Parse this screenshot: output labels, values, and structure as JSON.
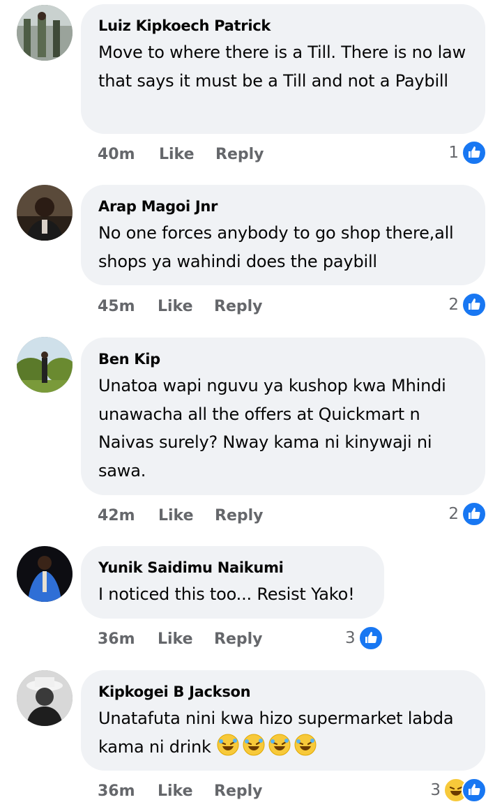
{
  "comments": [
    {
      "author": "Luiz Kipkoech Patrick",
      "text": "Move to where there is a Till. There is no law that says it must be a Till and not a Paybill",
      "time": "40m",
      "like": "Like",
      "reply": "Reply",
      "reaction_count": "1",
      "reactions": [
        "like-icon"
      ]
    },
    {
      "author": "Arap Magoi Jnr",
      "text": "No one forces anybody to go shop there,all shops ya wahindi does the paybill",
      "time": "45m",
      "like": "Like",
      "reply": "Reply",
      "reaction_count": "2",
      "reactions": [
        "like-icon"
      ]
    },
    {
      "author": "Ben Kip",
      "text": "Unatoa wapi nguvu ya kushop kwa Mhindi unawacha all the offers at Quickmart n Naivas surely? Nway kama ni kinywaji ni sawa.",
      "time": "42m",
      "like": "Like",
      "reply": "Reply",
      "reaction_count": "2",
      "reactions": [
        "like-icon"
      ]
    },
    {
      "author": "Yunik Saidimu Naikumi",
      "text": "I noticed this too... Resist Yako!",
      "time": "36m",
      "like": "Like",
      "reply": "Reply",
      "reaction_count": "3",
      "reactions": [
        "like-icon"
      ]
    },
    {
      "author": "Kipkogei B Jackson",
      "text": "Unatafuta nini kwa hizo supermarket labda kama ni drink",
      "text_emojis": [
        "rolling-laughing-emoji",
        "rolling-laughing-emoji",
        "rolling-laughing-emoji",
        "rolling-laughing-emoji"
      ],
      "time": "36m",
      "like": "Like",
      "reply": "Reply",
      "reaction_count": "3",
      "reactions": [
        "haha-icon",
        "like-icon"
      ]
    }
  ],
  "colors": {
    "bubble": "#f0f2f5",
    "meta_text": "#65676b",
    "like_blue": "#1877f2",
    "haha_yellow": "#f7c93a"
  }
}
